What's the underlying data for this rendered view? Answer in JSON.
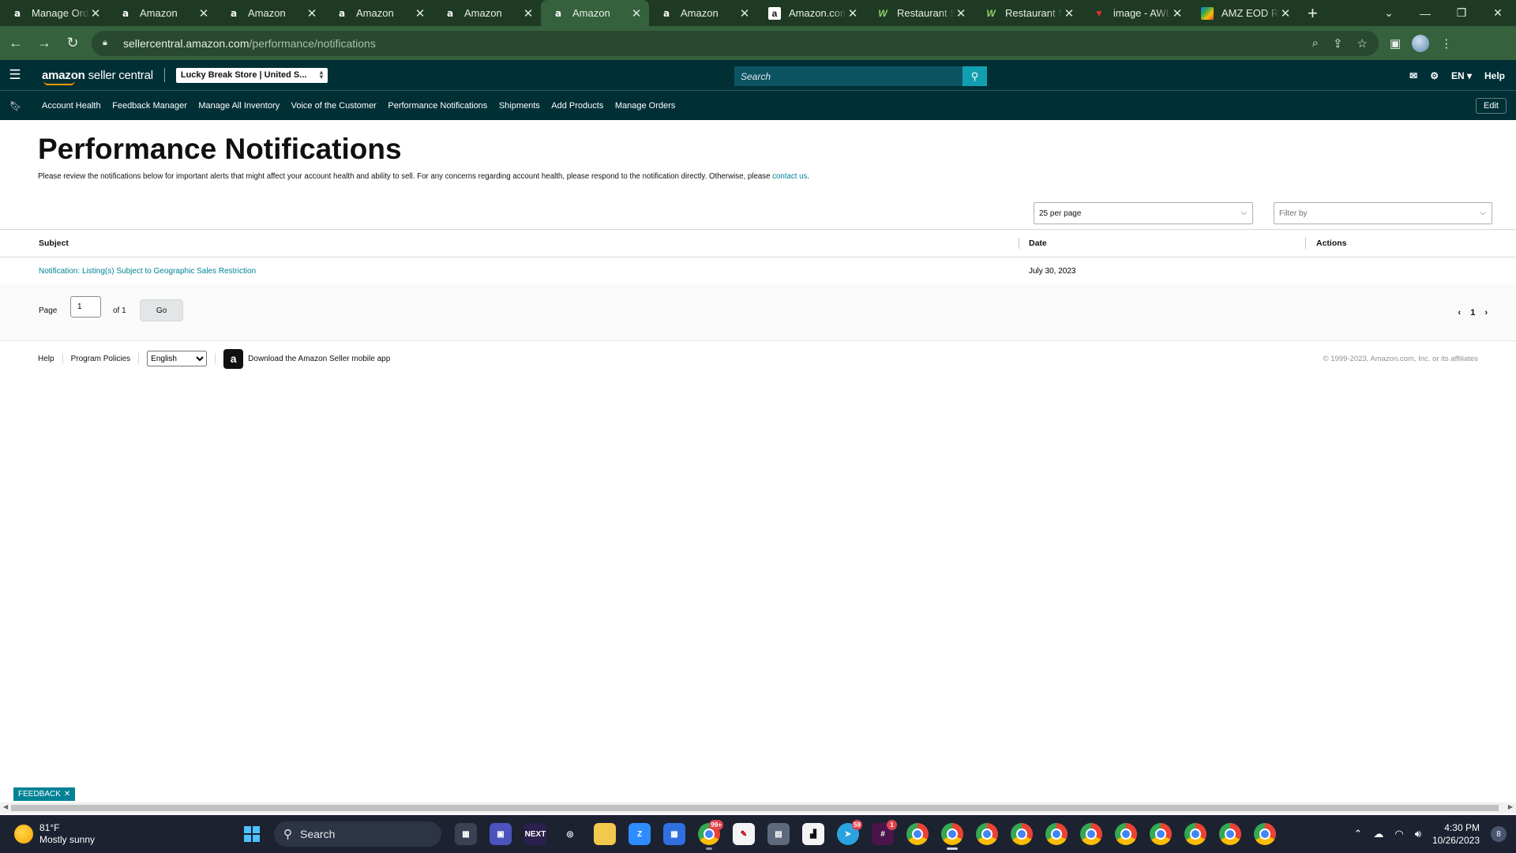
{
  "browser": {
    "tabs": [
      {
        "title": "Manage Ord",
        "favicon": "amazon-icon"
      },
      {
        "title": "Amazon",
        "favicon": "amazon-icon"
      },
      {
        "title": "Amazon",
        "favicon": "amazon-icon"
      },
      {
        "title": "Amazon",
        "favicon": "amazon-icon"
      },
      {
        "title": "Amazon",
        "favicon": "amazon-icon"
      },
      {
        "title": "Amazon",
        "favicon": "amazon-icon",
        "active": true
      },
      {
        "title": "Amazon",
        "favicon": "amazon-icon"
      },
      {
        "title": "Amazon.com",
        "favicon": "amazon-box-icon"
      },
      {
        "title": "Restaurant S",
        "favicon": "w-icon"
      },
      {
        "title": "Restaurant S",
        "favicon": "w-icon"
      },
      {
        "title": "image - AWL",
        "favicon": "red-icon"
      },
      {
        "title": "AMZ EOD Re",
        "favicon": "multicolor-icon"
      }
    ],
    "url_domain": "sellercentral.amazon.com",
    "url_path": "/performance/notifications"
  },
  "header": {
    "logo_bold": "amazon",
    "logo_light": " seller central",
    "store_selector": "Lucky Break Store | United S...",
    "search_placeholder": "Search",
    "language": "EN",
    "help": "Help",
    "accent": "#002f36"
  },
  "nav": {
    "links": [
      "Account Health",
      "Feedback Manager",
      "Manage All Inventory",
      "Voice of the Customer",
      "Performance Notifications",
      "Shipments",
      "Add Products",
      "Manage Orders"
    ],
    "edit": "Edit"
  },
  "page": {
    "title": "Performance Notifications",
    "intro": "Please review the notifications below for important alerts that might affect your account health and ability to sell. For any concerns regarding account health, please respond to the notification directly. Otherwise, please ",
    "intro_link": "contact us",
    "intro_end": "."
  },
  "controls": {
    "per_page": "25 per page",
    "filter_placeholder": "Filter by"
  },
  "table": {
    "headers": {
      "subject": "Subject",
      "date": "Date",
      "actions": "Actions"
    },
    "rows": [
      {
        "subject": "Notification: Listing(s) Subject to Geographic Sales Restriction",
        "date": "July 30, 2023",
        "actions": ""
      }
    ]
  },
  "pagination": {
    "page_label": "Page",
    "page_value": "1",
    "of_label": "of 1",
    "go": "Go",
    "current": "1"
  },
  "footer": {
    "help": "Help",
    "program_policies": "Program Policies",
    "language": "English",
    "app_text": "Download the Amazon Seller mobile app",
    "copyright": "© 1999-2023, Amazon.com, Inc. or its affiliates"
  },
  "feedback": "FEEDBACK",
  "taskbar": {
    "temperature": "81°F",
    "weather": "Mostly sunny",
    "search": "Search",
    "time": "4:30 PM",
    "date": "10/26/2023",
    "notifications": "8",
    "badges": {
      "chrome3": "99+",
      "telegram": "59",
      "slack": "1"
    }
  }
}
